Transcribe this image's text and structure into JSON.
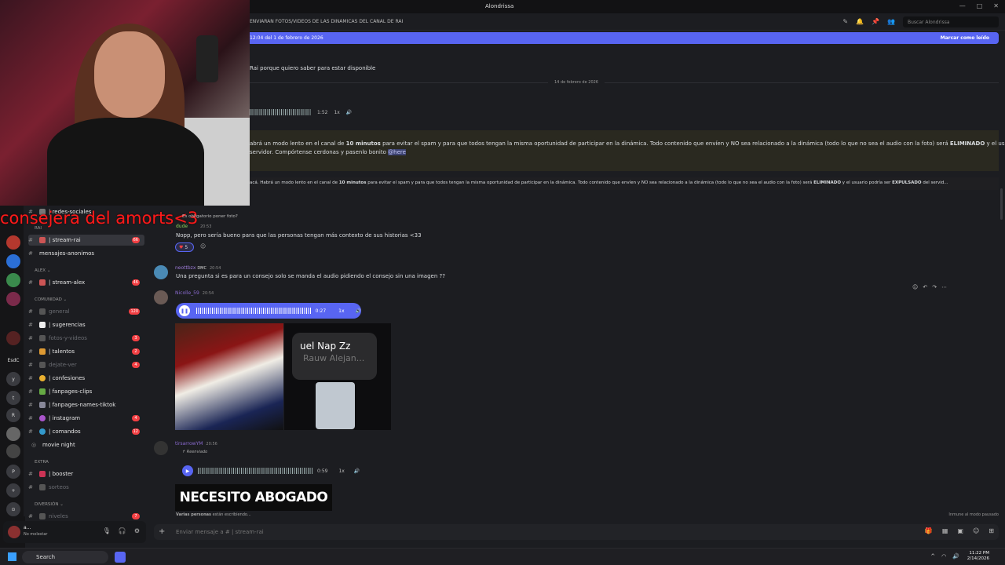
{
  "window": {
    "title": "Alondrissa",
    "controls": [
      "—",
      "□",
      "✕"
    ]
  },
  "channel_header": {
    "topic": "ENVIARAN FOTOS/VIDEOS DE LAS DINAMICAS DEL CANAL DE RAI",
    "search_placeholder": "Buscar Alondrissa"
  },
  "new_messages_bar": {
    "since": "12:04 del 1 de febrero de 2026",
    "mark_read": "Marcar como leído"
  },
  "messages_top": {
    "line1": "Rai porque quiero saber para estar disponible",
    "date_divider": "14 de febrero de 2026",
    "audio1_duration": "1:52",
    "audio1_speed": "1x",
    "announcement1_a_pre": "abrá un modo lento en el canal de ",
    "announcement1_a_b1": "10 minutos",
    "announcement1_a_mid": " para evitar el spam y para que todos tengan la misma oportunidad de participar en la dinámica. Todo contenido que envíen y NO sea relacionado a la dinámica (todo lo que no sea el audio con la foto) será ",
    "announcement1_a_b2": "ELIMINADO",
    "announcement1_a_post": " y el usuario",
    "announcement1_b": "servidor. Compórtense cerdonas y pasenlo bonito",
    "announcement1_mention": "@here",
    "announcement2_pre": "acá. Habrá un modo lento en el canal de ",
    "announcement2_b1": "10 minutos",
    "announcement2_mid": " para evitar el spam y para que todos tengan la misma oportunidad de participar en la dinámica. Todo contenido que envíen y NO sea relacionado a la dinámica (todo lo que no sea el audio con la foto) será ",
    "announcement2_b2": "ELIMINADO",
    "announcement2_mid2": " y el usuario podría ser ",
    "announcement2_b3": "EXPULSADO",
    "announcement2_post": " del servid..."
  },
  "overlay": {
    "text": "consejera del amorts<3"
  },
  "sidebar": {
    "categories": {
      "rai": "RAI",
      "alex": "ALEX ⌄",
      "comunidad": "COMUNIDAD ⌄",
      "extra": "EXTRA",
      "diversion": "DIVERSIÓN ⌄"
    },
    "channels": [
      {
        "label": "| redes-sociales",
        "badge": ""
      },
      {
        "label": "| stream-rai",
        "badge": "66"
      },
      {
        "label": "mensajes-anonimos",
        "badge": ""
      },
      {
        "label": "| stream-alex",
        "badge": "46"
      },
      {
        "label": "general",
        "badge": "120"
      },
      {
        "label": "| sugerencias",
        "badge": ""
      },
      {
        "label": "fotos-y-videos",
        "badge": "3"
      },
      {
        "label": "| talentos",
        "badge": "2"
      },
      {
        "label": "dejate-ver",
        "badge": "4"
      },
      {
        "label": "| confesiones",
        "badge": ""
      },
      {
        "label": "| fanpages-clips",
        "badge": ""
      },
      {
        "label": "| fanpages-names-tiktok",
        "badge": ""
      },
      {
        "label": "| instagram",
        "badge": "4"
      },
      {
        "label": "| comandos",
        "badge": "12"
      },
      {
        "label": "movie night",
        "badge": ""
      },
      {
        "label": "| booster",
        "badge": ""
      },
      {
        "label": "sorteos",
        "badge": ""
      },
      {
        "label": "niveles",
        "badge": "7"
      }
    ],
    "guild_labels": [
      "EsdC",
      "y",
      "t",
      "R",
      "P"
    ]
  },
  "chat": {
    "reply_question": "Es obligatorio poner foto?",
    "msg1_user": "dude",
    "msg1_time": "20:53",
    "msg1_text": "Nopp, pero sería bueno para que las personas tengan más contexto de sus historias <33",
    "msg1_reaction_count": "5",
    "msg2_user": "neottbzx",
    "msg2_tag": "DMC",
    "msg2_time": "20:54",
    "msg2_text": "Una pregunta si es para un consejo solo se manda el audio pidiendo el consejo sin una imagen ??",
    "msg3_user": "Nicolle_59",
    "msg3_time": "20:54",
    "msg3_audio_duration": "0:27",
    "msg3_audio_speed": "1x",
    "msg3_img2_title": "uel Nap Zz",
    "msg3_img2_sub": "Rauw Alejan...",
    "msg4_user": "tirsarrowYM",
    "msg4_time": "20:56",
    "msg4_forwarded": "Reenviado",
    "msg4_audio_duration": "0:59",
    "msg4_audio_speed": "1x",
    "msg4_image_text": "NECESITO ABOGADO",
    "typing_bold": "Varias personas",
    "typing_rest": " están escribiendo...",
    "slowmode": "Inmune al modo pausado",
    "composer_placeholder": "Enviar mensaje a #",
    "composer_channel": "| stream-rai"
  },
  "user_panel": {
    "name": "a...",
    "status": "No molestar"
  },
  "taskbar": {
    "search": "Search",
    "time": "11:22 PM",
    "date": "2/14/2026"
  }
}
